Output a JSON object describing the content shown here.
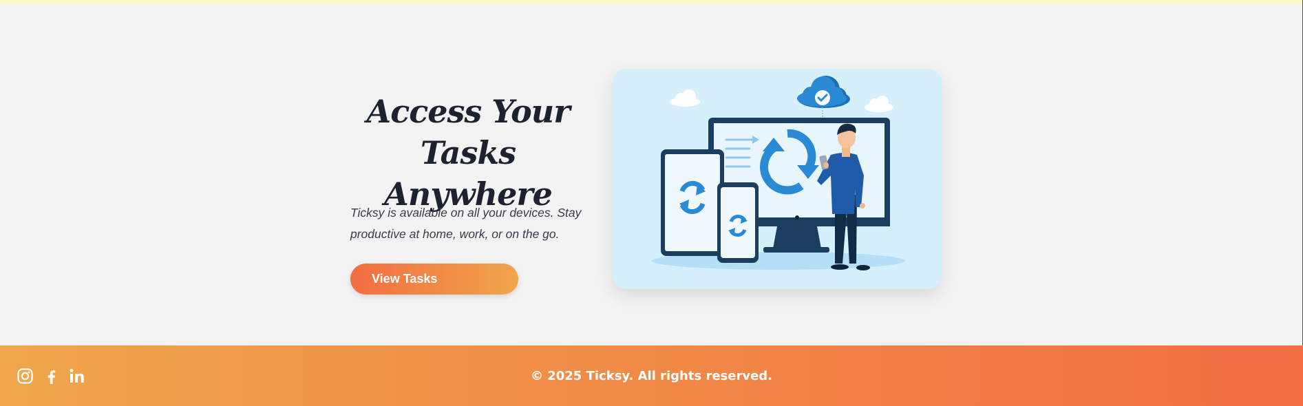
{
  "hero": {
    "title_line1": "Access Your",
    "title_line2": "Tasks Anywhere",
    "description_line1": "Ticksy is available on all your devices. Stay",
    "description_line2": "productive at home, work, or on the go.",
    "cta_label": "View Tasks"
  },
  "illustration": {
    "icons": [
      "cloud-check-icon",
      "sync-icon",
      "monitor-icon",
      "tablet-icon",
      "phone-icon",
      "person-figure"
    ]
  },
  "footer": {
    "social": [
      {
        "name": "Instagram",
        "icon": "instagram-icon"
      },
      {
        "name": "Facebook",
        "icon": "facebook-icon"
      },
      {
        "name": "LinkedIn",
        "icon": "linkedin-icon"
      }
    ],
    "copyright": "© 2025 Ticksy. All rights reserved."
  },
  "colors": {
    "accent_orange": "#f26d43",
    "accent_amber": "#f0a64a",
    "illustration_bg": "#d5effb",
    "sync_blue": "#2b8ad6",
    "heading": "#1e2230"
  }
}
